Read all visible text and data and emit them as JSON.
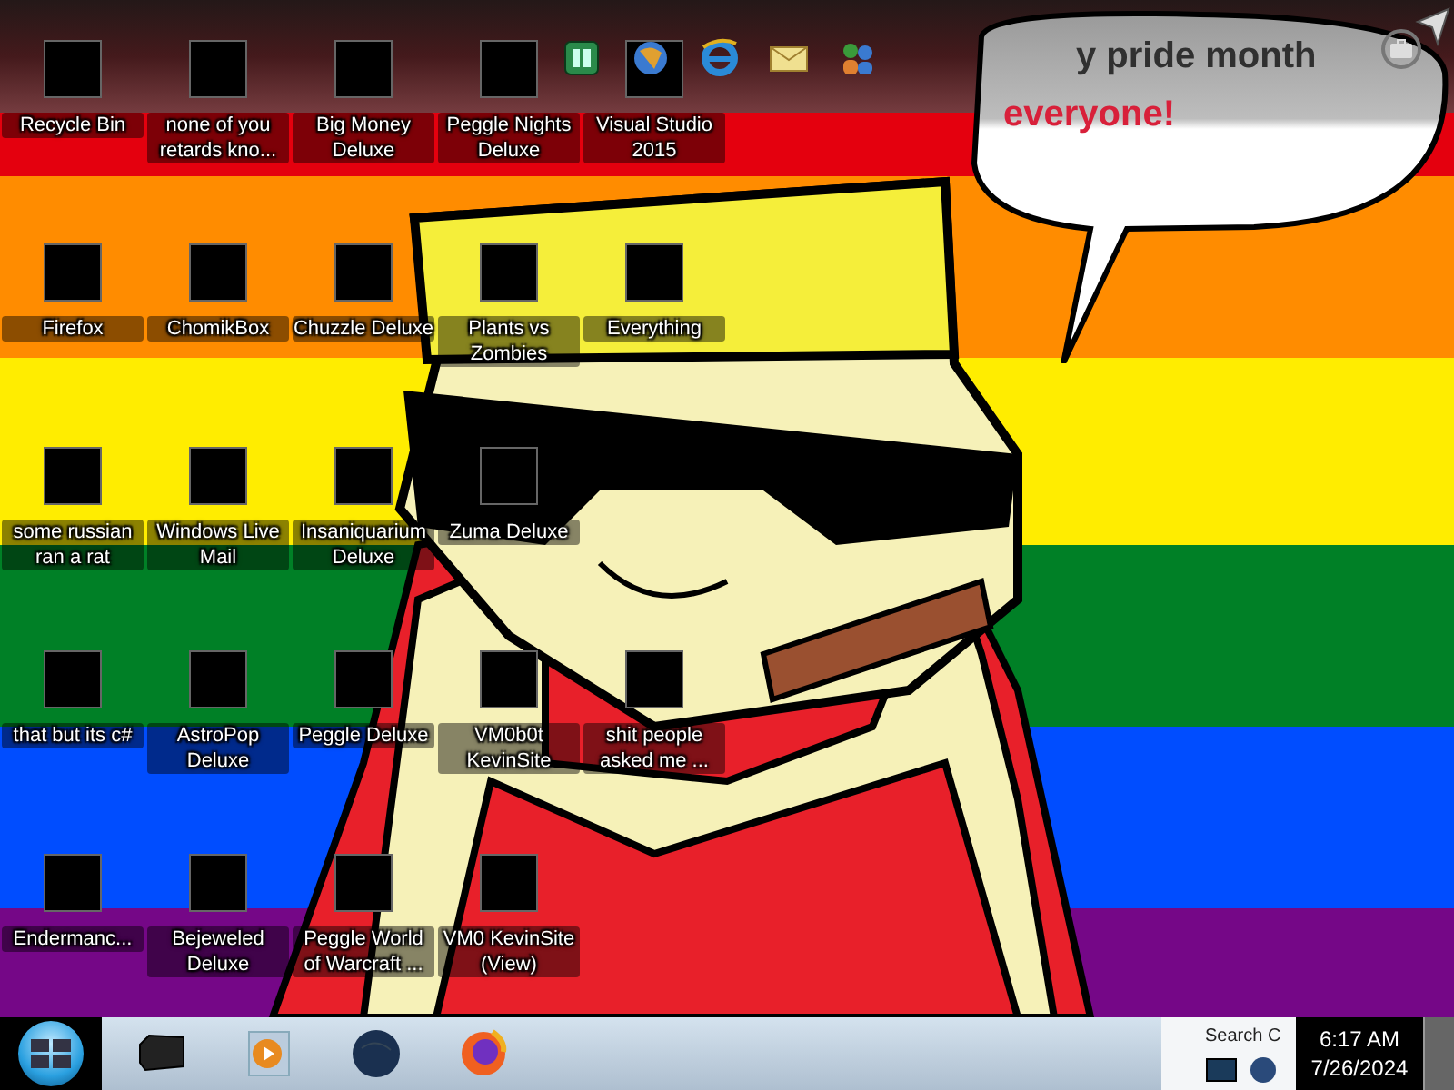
{
  "desktop": {
    "rows": [
      {
        "icons": [
          {
            "label": "Recycle Bin"
          },
          {
            "label": "none of you retards kno..."
          },
          {
            "label": "Big Money Deluxe"
          },
          {
            "label": "Peggle Nights Deluxe"
          },
          {
            "label": "Visual Studio 2015"
          }
        ]
      },
      {
        "icons": [
          {
            "label": "Firefox"
          },
          {
            "label": "ChomikBox"
          },
          {
            "label": "Chuzzle Deluxe"
          },
          {
            "label": "Plants vs Zombies"
          },
          {
            "label": "Everything"
          }
        ]
      },
      {
        "icons": [
          {
            "label": "some russian ran a rat"
          },
          {
            "label": "Windows Live Mail"
          },
          {
            "label": "Insaniquarium Deluxe"
          },
          {
            "label": "Zuma Deluxe"
          }
        ]
      },
      {
        "icons": [
          {
            "label": "that but its c#"
          },
          {
            "label": "AstroPop Deluxe"
          },
          {
            "label": "Peggle Deluxe"
          },
          {
            "label": "VM0b0t KevinSite"
          },
          {
            "label": "shit people asked me ..."
          }
        ]
      },
      {
        "icons": [
          {
            "label": "Endermanc..."
          },
          {
            "label": "Bejeweled Deluxe"
          },
          {
            "label": "Peggle World of Warcraft ..."
          },
          {
            "label": "VM0 KevinSite (View)"
          }
        ]
      }
    ]
  },
  "wallpaper": {
    "bubble_lines": [
      "y pride month",
      "everyone!"
    ]
  },
  "dock": {
    "icons": [
      {
        "kind": "cube"
      },
      {
        "kind": "globe"
      },
      {
        "kind": "browser"
      },
      {
        "kind": "mail"
      },
      {
        "kind": "people"
      }
    ]
  },
  "taskbar": {
    "pinned": [
      {
        "kind": "box"
      },
      {
        "kind": "player"
      },
      {
        "kind": "globe"
      },
      {
        "kind": "firefox"
      }
    ],
    "tray_text": "Search C",
    "time": "6:17 AM",
    "date": "7/26/2024"
  }
}
